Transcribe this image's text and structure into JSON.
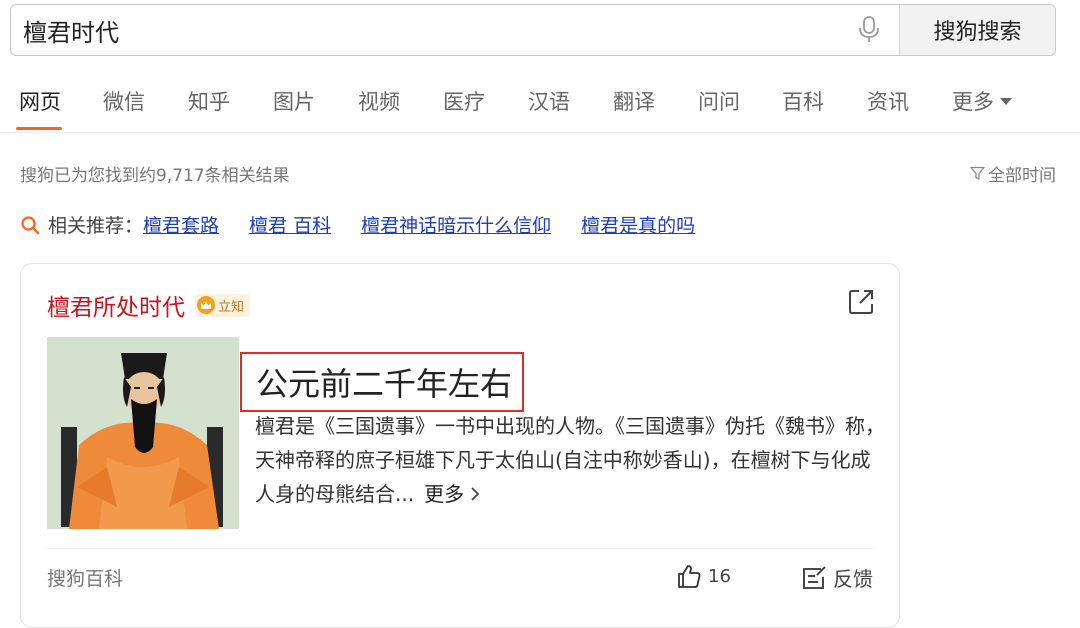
{
  "search": {
    "query": "檀君时代",
    "button_label": "搜狗搜索"
  },
  "tabs": [
    {
      "label": "网页",
      "active": true
    },
    {
      "label": "微信"
    },
    {
      "label": "知乎"
    },
    {
      "label": "图片"
    },
    {
      "label": "视频"
    },
    {
      "label": "医疗"
    },
    {
      "label": "汉语"
    },
    {
      "label": "翻译"
    },
    {
      "label": "问问"
    },
    {
      "label": "百科"
    },
    {
      "label": "资讯"
    },
    {
      "label": "更多"
    }
  ],
  "results_info": {
    "count_text": "搜狗已为您找到约9,717条相关结果",
    "time_filter": "全部时间"
  },
  "related": {
    "label": "相关推荐：",
    "links": [
      "檀君套路",
      "檀君 百科",
      "檀君神话暗示什么信仰",
      "檀君是真的吗"
    ]
  },
  "card": {
    "title": "檀君所处时代",
    "badge": "立知",
    "answer": "公元前二千年左右",
    "description": "檀君是《三国遗事》一书中出现的人物。《三国遗事》伪托《魏书》称，天神帝释的庶子桓雄下凡于太伯山(自注中称妙香山)，在檀树下与化成人身的母熊结合...",
    "more": "更多",
    "source": "搜狗百科",
    "likes": "16",
    "feedback": "反馈"
  },
  "colors": {
    "accent": "#f26522",
    "title_red": "#c4161c",
    "link_blue": "#1f3fb0",
    "highlight_border": "#e02b2b"
  },
  "icons": [
    "microphone-icon",
    "search-icon",
    "filter-icon",
    "share-icon",
    "thumbs-up-icon",
    "feedback-icon",
    "crown-badge-icon",
    "chevron-right-icon",
    "caret-down-icon"
  ]
}
